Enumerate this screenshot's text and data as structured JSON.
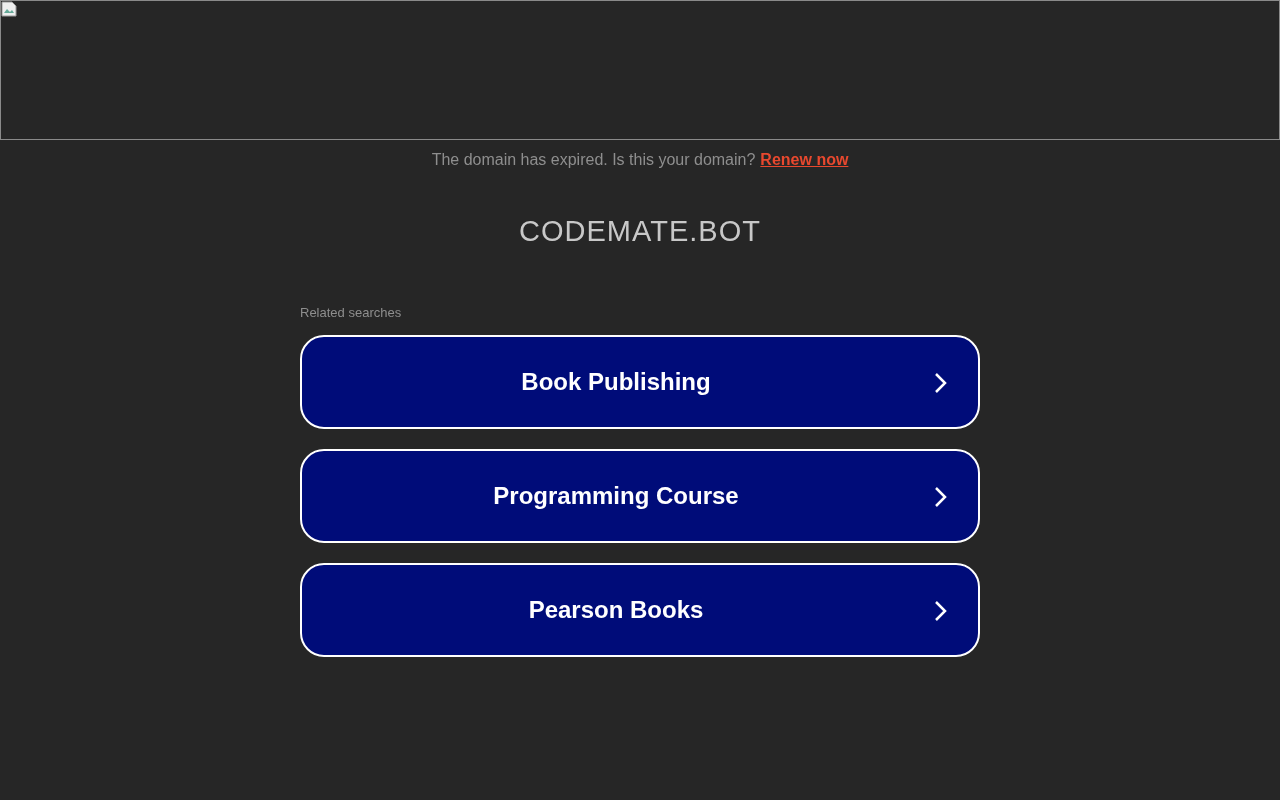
{
  "banner": {
    "kind": "broken-image"
  },
  "notice": {
    "text": "The domain has expired. Is this your domain?",
    "link": "Renew now"
  },
  "domain": "CODEMATE.BOT",
  "related": {
    "heading": "Related searches",
    "items": [
      {
        "label": "Book Publishing"
      },
      {
        "label": "Programming Course"
      },
      {
        "label": "Pearson Books"
      }
    ]
  }
}
